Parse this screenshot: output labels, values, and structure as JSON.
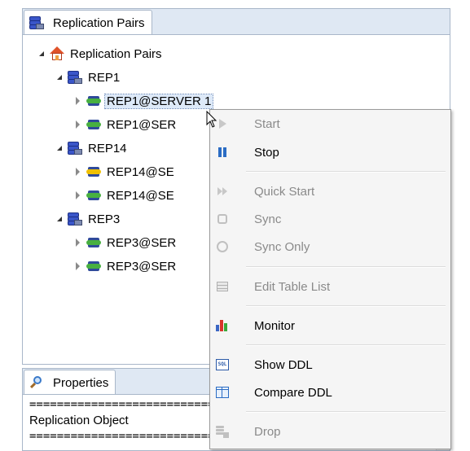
{
  "top_panel": {
    "tab_label": "Replication Pairs",
    "tree": {
      "root_label": "Replication Pairs",
      "groups": [
        {
          "label": "REP1",
          "children": [
            {
              "label": "REP1@SERVER 1",
              "status": "green",
              "selected": true
            },
            {
              "label": "REP1@SER",
              "status": "green"
            }
          ]
        },
        {
          "label": "REP14",
          "children": [
            {
              "label": "REP14@SE",
              "status": "yellow"
            },
            {
              "label": "REP14@SE",
              "status": "green"
            }
          ]
        },
        {
          "label": "REP3",
          "children": [
            {
              "label": "REP3@SER",
              "status": "green"
            },
            {
              "label": "REP3@SER",
              "status": "green"
            }
          ]
        }
      ]
    }
  },
  "bottom_panel": {
    "tab_label": "Properties",
    "lines": [
      "=======================================================",
      "Replication Object",
      "======================================================="
    ]
  },
  "context_menu": {
    "items": [
      {
        "label": "Start",
        "enabled": false,
        "icon": "play-icon"
      },
      {
        "label": "Stop",
        "enabled": true,
        "icon": "pause-icon"
      },
      {
        "label": "Quick Start",
        "enabled": false,
        "icon": "fast-forward-icon"
      },
      {
        "label": "Sync",
        "enabled": false,
        "icon": "sync-icon"
      },
      {
        "label": "Sync Only",
        "enabled": false,
        "icon": "sync-only-icon"
      },
      {
        "label": "Edit Table List",
        "enabled": false,
        "icon": "edit-table-icon"
      },
      {
        "label": "Monitor",
        "enabled": true,
        "icon": "bar-chart-icon"
      },
      {
        "label": "Show DDL",
        "enabled": true,
        "icon": "sql-icon"
      },
      {
        "label": "Compare DDL",
        "enabled": true,
        "icon": "compare-icon"
      },
      {
        "label": "Drop",
        "enabled": false,
        "icon": "drop-icon"
      }
    ]
  },
  "colors": {
    "panel_border": "#a9b7c9",
    "tab_strip": "#dfe8f3",
    "selection": "#dde9f8",
    "menu_bg": "#f5f5f5",
    "disabled_text": "#8a8a8a"
  }
}
